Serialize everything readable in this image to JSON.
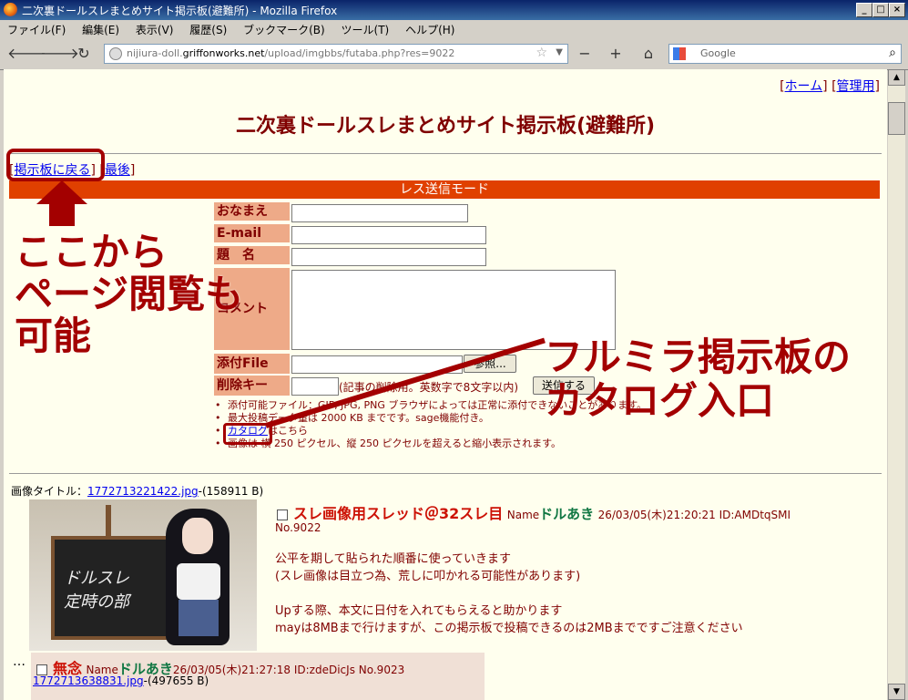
{
  "window": {
    "title": "二次裏ドールスレまとめサイト掲示板(避難所) - Mozilla Firefox"
  },
  "menu": [
    "ファイル(F)",
    "編集(E)",
    "表示(V)",
    "履歴(S)",
    "ブックマーク(B)",
    "ツール(T)",
    "ヘルプ(H)"
  ],
  "nav": {
    "url_host_prefix": "nijiura-doll.",
    "url_host_main": "griffonworks.net",
    "url_path": "/upload/imgbbs/futaba.php?res=9022",
    "search_placeholder": "Google"
  },
  "toplinks": {
    "home": "ホーム",
    "admin": "管理用"
  },
  "board_title": "二次裏ドールスレまとめサイト掲示板(避難所)",
  "backlinks": {
    "back": "掲示板に戻る",
    "last": "最後"
  },
  "mode_bar": "レス送信モード",
  "form": {
    "name_label": "おなまえ",
    "email_label": "E-mail",
    "subject_label": "題　名",
    "comment_label": "コメント",
    "file_label": "添付File",
    "delkey_label": "削除キー",
    "browse_button": "参照...",
    "delkey_note": "(記事の削除用。英数字で8文字以内)",
    "submit_button": "送信する"
  },
  "notes": {
    "n1": "添付可能ファイル：GIF, JPG, PNG ブラウザによっては正常に添付できないことがあります。",
    "n2": "最大投稿データ量は 2000 KB までです。sage機能付き。",
    "catalog_link": "カタログ",
    "catalog_suffix": "はこちら",
    "n4": "画像は 横 250 ピクセル、縦 250 ピクセルを超えると縮小表示されます。"
  },
  "thread": {
    "image_title_label": "画像タイトル：",
    "image_file": "1772713221422.jpg",
    "image_size": "-(158911 B)",
    "subject": "スレ画像用スレッド＠32スレ目",
    "name_label": "Name",
    "name": "ドルあき",
    "datetime": "26/03/05(木)21:20:21 ID:AMDtqSMI",
    "post_no": "No.9022",
    "body_l1": "公平を期して貼られた順番に使っていきます",
    "body_l2": "(スレ画像は目立つ為、荒しに叩かれる可能性があります)",
    "body_l3": "Upする際、本文に日付を入れてもらえると助かります",
    "body_l4": "mayは8MBまで行けますが、この掲示板で投稿できるのは2MBまでですご注意ください",
    "chalk_l1": "ドルスレ",
    "chalk_l2": "定時の部"
  },
  "reply": {
    "ellipsis": "…",
    "subject": "無念",
    "name_label": "Name",
    "name": "ドルあき",
    "datetime_id_no": "26/03/05(木)21:27:18 ID:zdeDicJs No.9023",
    "file": "1772713638831.jpg",
    "size": "-(497655 B)"
  },
  "annotations": {
    "left_l1": "ここから",
    "left_l2": "ページ閲覧も",
    "left_l3": "可能",
    "right_l1": "フルミラ掲示板の",
    "right_l2": "カタログ入口"
  }
}
